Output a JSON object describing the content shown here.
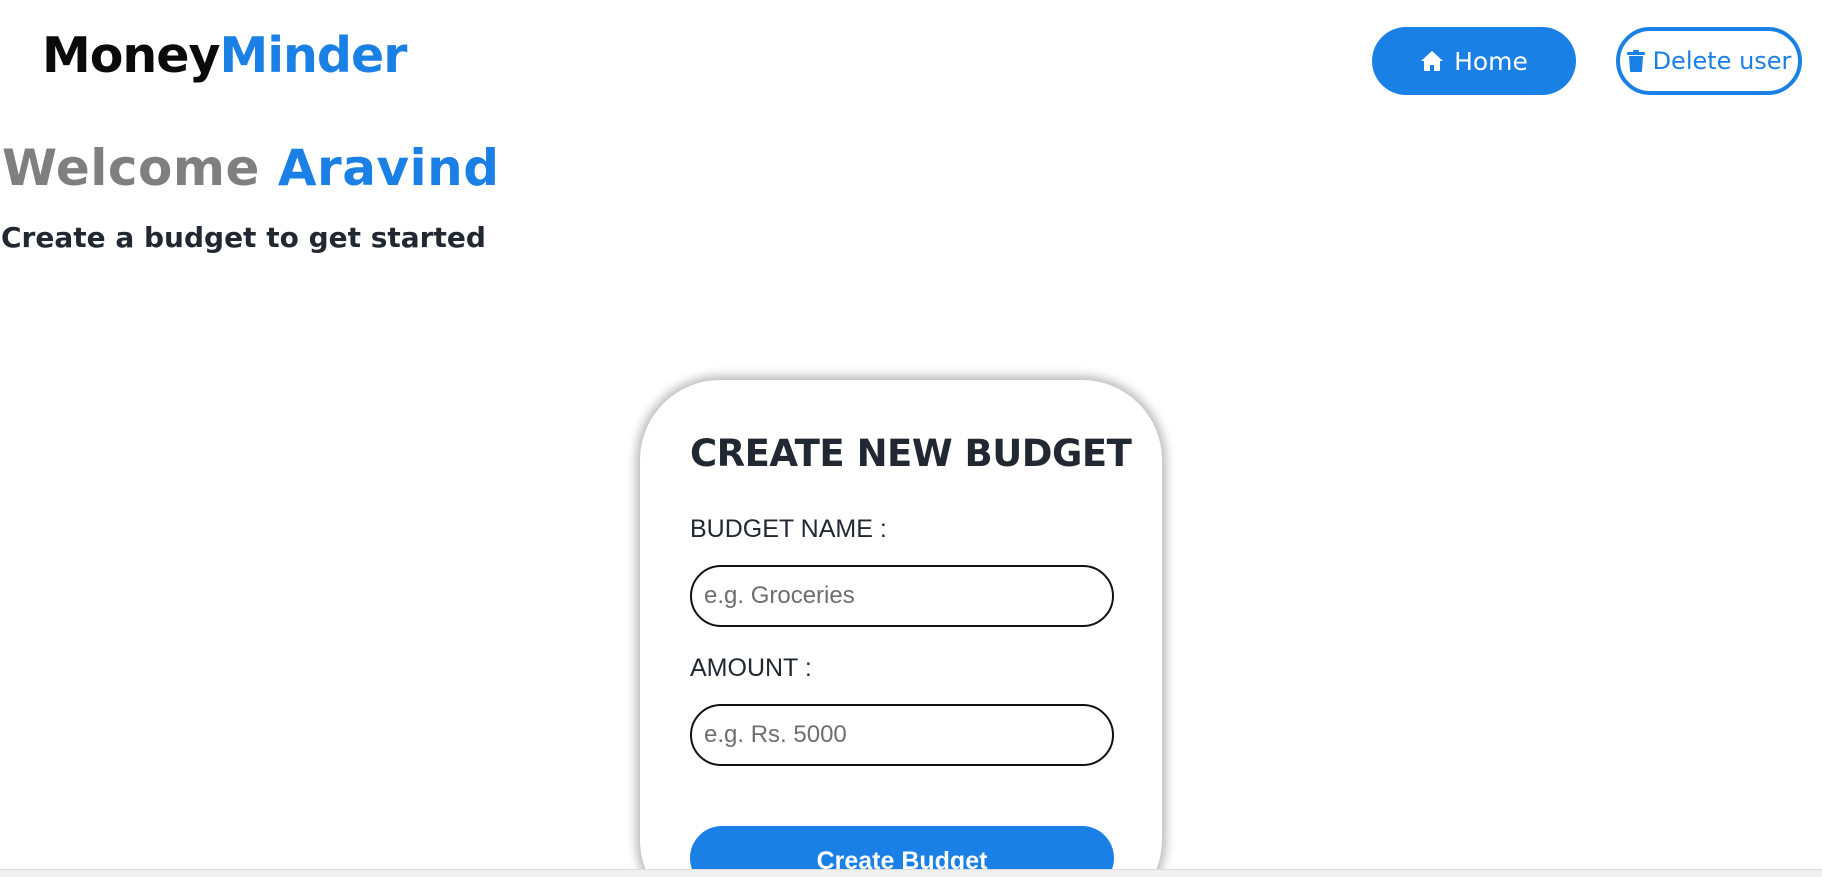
{
  "brand": {
    "part1": "Money",
    "part2": "Minder"
  },
  "nav": {
    "home_label": "Home",
    "home_icon": "home-icon",
    "delete_label": "Delete user",
    "delete_icon": "trash-icon"
  },
  "welcome": {
    "greeting": "Welcome",
    "username": "Aravind",
    "subtitle": "Create a budget to get started"
  },
  "form": {
    "title": "CREATE NEW BUDGET",
    "name_label": "BUDGET NAME :",
    "name_placeholder": "e.g. Groceries",
    "name_value": "",
    "amount_label": "AMOUNT :",
    "amount_placeholder": "e.g. Rs. 5000",
    "amount_value": "",
    "submit_label": "Create Budget"
  },
  "colors": {
    "accent": "#1a80e5",
    "text_dark": "#222831",
    "greeting_gray": "#7f7f7f"
  }
}
